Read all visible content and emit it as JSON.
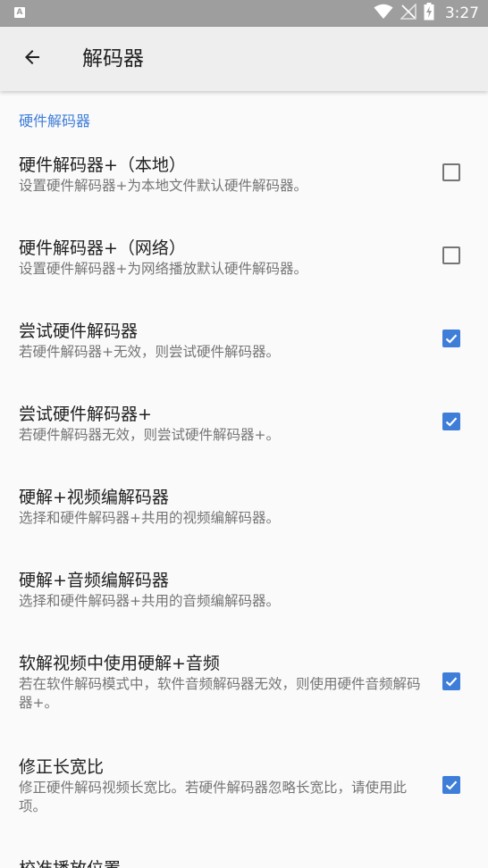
{
  "status_bar": {
    "app_icon_letter": "A",
    "time": "3:27"
  },
  "toolbar": {
    "title": "解码器"
  },
  "section": {
    "header": "硬件解码器"
  },
  "items": [
    {
      "title": "硬件解码器+（本地）",
      "subtitle": "设置硬件解码器+为本地文件默认硬件解码器。",
      "checked": false
    },
    {
      "title": "硬件解码器+（网络）",
      "subtitle": "设置硬件解码器+为网络播放默认硬件解码器。",
      "checked": false
    },
    {
      "title": "尝试硬件解码器",
      "subtitle": "若硬件解码器+无效，则尝试硬件解码器。",
      "checked": true
    },
    {
      "title": "尝试硬件解码器+",
      "subtitle": "若硬件解码器无效，则尝试硬件解码器+。",
      "checked": true
    },
    {
      "title": "硬解+视频编解码器",
      "subtitle": "选择和硬件解码器+共用的视频编解码器。"
    },
    {
      "title": "硬解+音频编解码器",
      "subtitle": "选择和硬件解码器+共用的音频编解码器。"
    },
    {
      "title": "软解视频中使用硬解+音频",
      "subtitle": "若在软件解码模式中，软件音频解码器无效，则使用硬件音频解码器+。",
      "checked": true
    },
    {
      "title": "修正长宽比",
      "subtitle": "修正硬件解码视频长宽比。若硬件解码器忽略长宽比，请使用此项。",
      "checked": true
    },
    {
      "title": "校准播放位置"
    }
  ],
  "colors": {
    "accent": "#3f7ed8",
    "status_bar": "#9e9e9e",
    "toolbar": "#eeeeee",
    "background": "#fafafa"
  }
}
